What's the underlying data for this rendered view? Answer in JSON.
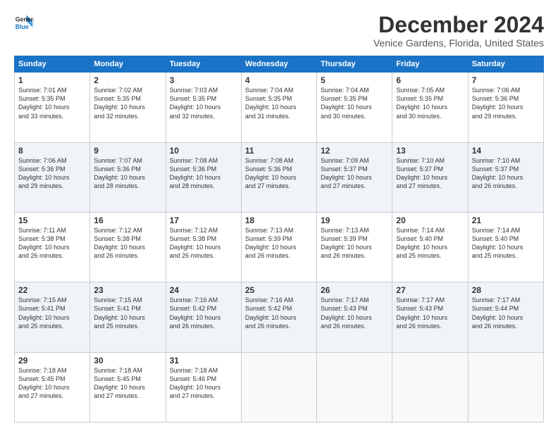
{
  "header": {
    "logo_line1": "General",
    "logo_line2": "Blue",
    "month_title": "December 2024",
    "subtitle": "Venice Gardens, Florida, United States"
  },
  "days_of_week": [
    "Sunday",
    "Monday",
    "Tuesday",
    "Wednesday",
    "Thursday",
    "Friday",
    "Saturday"
  ],
  "weeks": [
    [
      {
        "day": "1",
        "info": "Sunrise: 7:01 AM\nSunset: 5:35 PM\nDaylight: 10 hours\nand 33 minutes."
      },
      {
        "day": "2",
        "info": "Sunrise: 7:02 AM\nSunset: 5:35 PM\nDaylight: 10 hours\nand 32 minutes."
      },
      {
        "day": "3",
        "info": "Sunrise: 7:03 AM\nSunset: 5:35 PM\nDaylight: 10 hours\nand 32 minutes."
      },
      {
        "day": "4",
        "info": "Sunrise: 7:04 AM\nSunset: 5:35 PM\nDaylight: 10 hours\nand 31 minutes."
      },
      {
        "day": "5",
        "info": "Sunrise: 7:04 AM\nSunset: 5:35 PM\nDaylight: 10 hours\nand 30 minutes."
      },
      {
        "day": "6",
        "info": "Sunrise: 7:05 AM\nSunset: 5:35 PM\nDaylight: 10 hours\nand 30 minutes."
      },
      {
        "day": "7",
        "info": "Sunrise: 7:06 AM\nSunset: 5:36 PM\nDaylight: 10 hours\nand 29 minutes."
      }
    ],
    [
      {
        "day": "8",
        "info": "Sunrise: 7:06 AM\nSunset: 5:36 PM\nDaylight: 10 hours\nand 29 minutes."
      },
      {
        "day": "9",
        "info": "Sunrise: 7:07 AM\nSunset: 5:36 PM\nDaylight: 10 hours\nand 28 minutes."
      },
      {
        "day": "10",
        "info": "Sunrise: 7:08 AM\nSunset: 5:36 PM\nDaylight: 10 hours\nand 28 minutes."
      },
      {
        "day": "11",
        "info": "Sunrise: 7:08 AM\nSunset: 5:36 PM\nDaylight: 10 hours\nand 27 minutes."
      },
      {
        "day": "12",
        "info": "Sunrise: 7:09 AM\nSunset: 5:37 PM\nDaylight: 10 hours\nand 27 minutes."
      },
      {
        "day": "13",
        "info": "Sunrise: 7:10 AM\nSunset: 5:37 PM\nDaylight: 10 hours\nand 27 minutes."
      },
      {
        "day": "14",
        "info": "Sunrise: 7:10 AM\nSunset: 5:37 PM\nDaylight: 10 hours\nand 26 minutes."
      }
    ],
    [
      {
        "day": "15",
        "info": "Sunrise: 7:11 AM\nSunset: 5:38 PM\nDaylight: 10 hours\nand 26 minutes."
      },
      {
        "day": "16",
        "info": "Sunrise: 7:12 AM\nSunset: 5:38 PM\nDaylight: 10 hours\nand 26 minutes."
      },
      {
        "day": "17",
        "info": "Sunrise: 7:12 AM\nSunset: 5:38 PM\nDaylight: 10 hours\nand 26 minutes."
      },
      {
        "day": "18",
        "info": "Sunrise: 7:13 AM\nSunset: 5:39 PM\nDaylight: 10 hours\nand 26 minutes."
      },
      {
        "day": "19",
        "info": "Sunrise: 7:13 AM\nSunset: 5:39 PM\nDaylight: 10 hours\nand 26 minutes."
      },
      {
        "day": "20",
        "info": "Sunrise: 7:14 AM\nSunset: 5:40 PM\nDaylight: 10 hours\nand 25 minutes."
      },
      {
        "day": "21",
        "info": "Sunrise: 7:14 AM\nSunset: 5:40 PM\nDaylight: 10 hours\nand 25 minutes."
      }
    ],
    [
      {
        "day": "22",
        "info": "Sunrise: 7:15 AM\nSunset: 5:41 PM\nDaylight: 10 hours\nand 25 minutes."
      },
      {
        "day": "23",
        "info": "Sunrise: 7:15 AM\nSunset: 5:41 PM\nDaylight: 10 hours\nand 25 minutes."
      },
      {
        "day": "24",
        "info": "Sunrise: 7:16 AM\nSunset: 5:42 PM\nDaylight: 10 hours\nand 26 minutes."
      },
      {
        "day": "25",
        "info": "Sunrise: 7:16 AM\nSunset: 5:42 PM\nDaylight: 10 hours\nand 26 minutes."
      },
      {
        "day": "26",
        "info": "Sunrise: 7:17 AM\nSunset: 5:43 PM\nDaylight: 10 hours\nand 26 minutes."
      },
      {
        "day": "27",
        "info": "Sunrise: 7:17 AM\nSunset: 5:43 PM\nDaylight: 10 hours\nand 26 minutes."
      },
      {
        "day": "28",
        "info": "Sunrise: 7:17 AM\nSunset: 5:44 PM\nDaylight: 10 hours\nand 26 minutes."
      }
    ],
    [
      {
        "day": "29",
        "info": "Sunrise: 7:18 AM\nSunset: 5:45 PM\nDaylight: 10 hours\nand 27 minutes."
      },
      {
        "day": "30",
        "info": "Sunrise: 7:18 AM\nSunset: 5:45 PM\nDaylight: 10 hours\nand 27 minutes."
      },
      {
        "day": "31",
        "info": "Sunrise: 7:18 AM\nSunset: 5:46 PM\nDaylight: 10 hours\nand 27 minutes."
      },
      {
        "day": "",
        "info": ""
      },
      {
        "day": "",
        "info": ""
      },
      {
        "day": "",
        "info": ""
      },
      {
        "day": "",
        "info": ""
      }
    ]
  ]
}
